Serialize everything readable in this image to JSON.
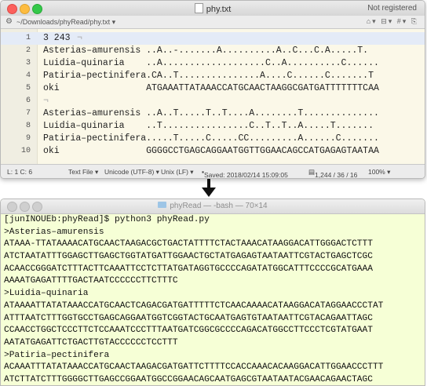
{
  "editor_window": {
    "title": "phy.txt",
    "registration": "Not registered",
    "path": "~/Downloads/phyRead/phy.txt",
    "path_chevron": "▾",
    "toolbar_icons": "⌂▾ ⊟▾ #▾ ⎘",
    "invisible_char": "¬",
    "lines": [
      {
        "num": "1",
        "text": "3 243"
      },
      {
        "num": "2",
        "text": "Asterias–amurensis ..A..-.......A..........A..C...C.A.....T."
      },
      {
        "num": "3",
        "text": "Luidia–quinaria    ..A...................C..A..........C......"
      },
      {
        "num": "4",
        "text": "Patiria–pectinifera.CA..T...............A....C......C.......T"
      },
      {
        "num": "5",
        "text": "oki                ATGAAATTATAAACCATGCAACTAAGGCGATGATTTTTTTCAA"
      },
      {
        "num": "6",
        "text": ""
      },
      {
        "num": "7",
        "text": "Asterias–amurensis ..A..T.....T..T....A........T.............."
      },
      {
        "num": "8",
        "text": "Luidia–quinaria    ..T................C..T..T..A.....T......."
      },
      {
        "num": "9",
        "text": "Patiria–pectinifera.....T.....C.....CC.........A......C......."
      },
      {
        "num": "10",
        "text": "oki                GGGGCCTGAGCAGGAATGGTTGGAACAGCCATGAGAGTAATAA"
      }
    ],
    "status": {
      "position": "L: 1 C: 6",
      "file_type": "Text File ▾",
      "encoding": "Unicode (UTF-8) ▾",
      "line_endings": "Unix (LF) ▾",
      "saved": "Saved: 2018/02/14 15:09:05",
      "stats": "1,244 / 36 / 16",
      "zoom": "100% ▾"
    }
  },
  "terminal_window": {
    "title": "phyRead — -bash — 70×14",
    "lines": [
      "[junINOUEb:phyRead]$ python3 phyRead.py",
      ">Asterias–amurensis",
      "ATAAA-TTATAAAACATGCAACTAAGACGCTGACTATTTTCTACTAAACATAAGGACATTGGGACTCTTT",
      "ATCTAATATTTGGAGCTTGAGCTGGTATGATTGGAACTGCTATGAGAGTAATAATTCGTACTGAGCTCGC",
      "ACAACCGGGATCTTTACTTCAAATTCCTCTTATGATAGGTGCCCCAGATATGGCATTTCCCCGCATGAAA",
      "AAAATGAGATTTTGACTAATCCCCCCTTCTTTC",
      ">Luidia–quinaria",
      "ATAAAATTATATAAACCATGCAACTCAGACGATGATTTTTCTCAACAAAACATAAGGACATAGGAACCCTAT",
      "ATTTAATCTTTGGTGCCTGAGCAGGAATGGTCGGTACTGCAATGAGTGTAATAATTCGTACAGAATTAGC",
      "CCAACCTGGCTCCCTTCTCCAAATCCCTTTAATGATCGGCGCCCCAGACATGGCCTTCCCTCGTATGAAT",
      "AATATGAGATTCTGACTTGTACCCCCCTCCTTT",
      ">Patiria–pectinifera",
      "ACAAATTTATATAAACCATGCAACTAAGACGATGATTCTTTTCCACCAAACACAAGGACATTGGAACCCTTT",
      "ATCTTATCTTTGGGGCTTGAGCCGGAATGGCCGGAACAGCAATGAGCGTAATAATACGAACAGAACTAGC"
    ]
  }
}
